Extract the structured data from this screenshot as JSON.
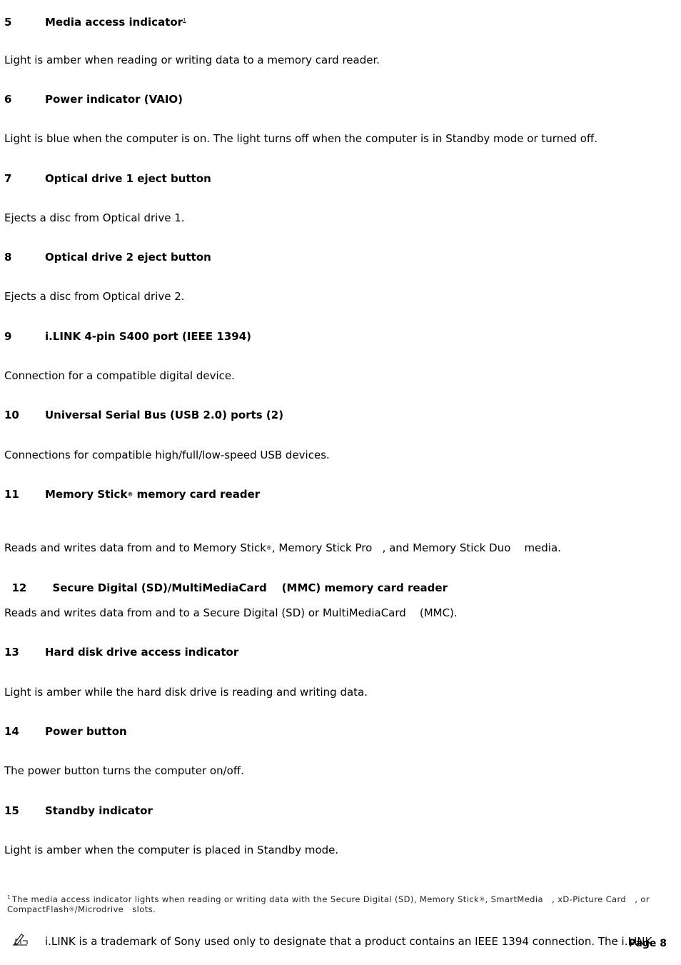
{
  "items": [
    {
      "num": "5",
      "title": "Media access indicator",
      "footnote_ref": "1",
      "desc": "Light is amber when reading or writing data to a memory card reader."
    },
    {
      "num": "6",
      "title": "Power indicator (VAIO)",
      "desc": "Light is blue when the computer is on. The light turns off when the computer is in Standby mode or turned off."
    },
    {
      "num": "7",
      "title": "Optical drive 1 eject button",
      "desc": "Ejects a disc from Optical drive 1."
    },
    {
      "num": "8",
      "title": "Optical drive 2 eject button",
      "desc": "Ejects a disc from Optical drive 2."
    },
    {
      "num": "9",
      "title": "i.LINK 4-pin S400 port (IEEE 1394)",
      "desc": "Connection for a compatible digital device."
    },
    {
      "num": "10",
      "title": "Universal Serial Bus (USB 2.0) ports (2)",
      "desc": "Connections for compatible high/full/low-speed USB devices."
    },
    {
      "num": "11",
      "title_a": "Memory Stick",
      "title_reg": "®",
      "title_b": " memory card reader",
      "desc_a": "Reads and writes data from and to Memory Stick",
      "desc_reg": "®",
      "desc_b": ", Memory Stick Pro   , and Memory Stick Duo    media."
    },
    {
      "num": "12",
      "title": "Secure Digital (SD)/MultiMediaCard    (MMC) memory card reader",
      "desc": "Reads and writes data from and to a Secure Digital (SD) or MultiMediaCard    (MMC)."
    },
    {
      "num": "13",
      "title": "Hard disk drive access indicator",
      "desc": "Light is amber while the hard disk drive is reading and writing data."
    },
    {
      "num": "14",
      "title": "Power button",
      "desc": "The power button turns the computer on/off."
    },
    {
      "num": "15",
      "title": "Standby indicator",
      "desc": "Light is amber when the computer is placed in Standby mode."
    }
  ],
  "footnote": {
    "mark": "1",
    "text_a": "The media access indicator lights when reading or writing data with the Secure Digital (SD), Memory Stick",
    "reg1": "®",
    "text_b": ", SmartMedia   , xD-Picture Card   , or CompactFlash",
    "reg2": "®",
    "text_c": "/Microdrive   slots."
  },
  "note": {
    "icon": "note-pencil-icon",
    "text": "i.LINK is a trademark of Sony used only to designate that a product contains an IEEE 1394 connection. The i.LINK"
  },
  "page": {
    "label": "Page 8"
  }
}
